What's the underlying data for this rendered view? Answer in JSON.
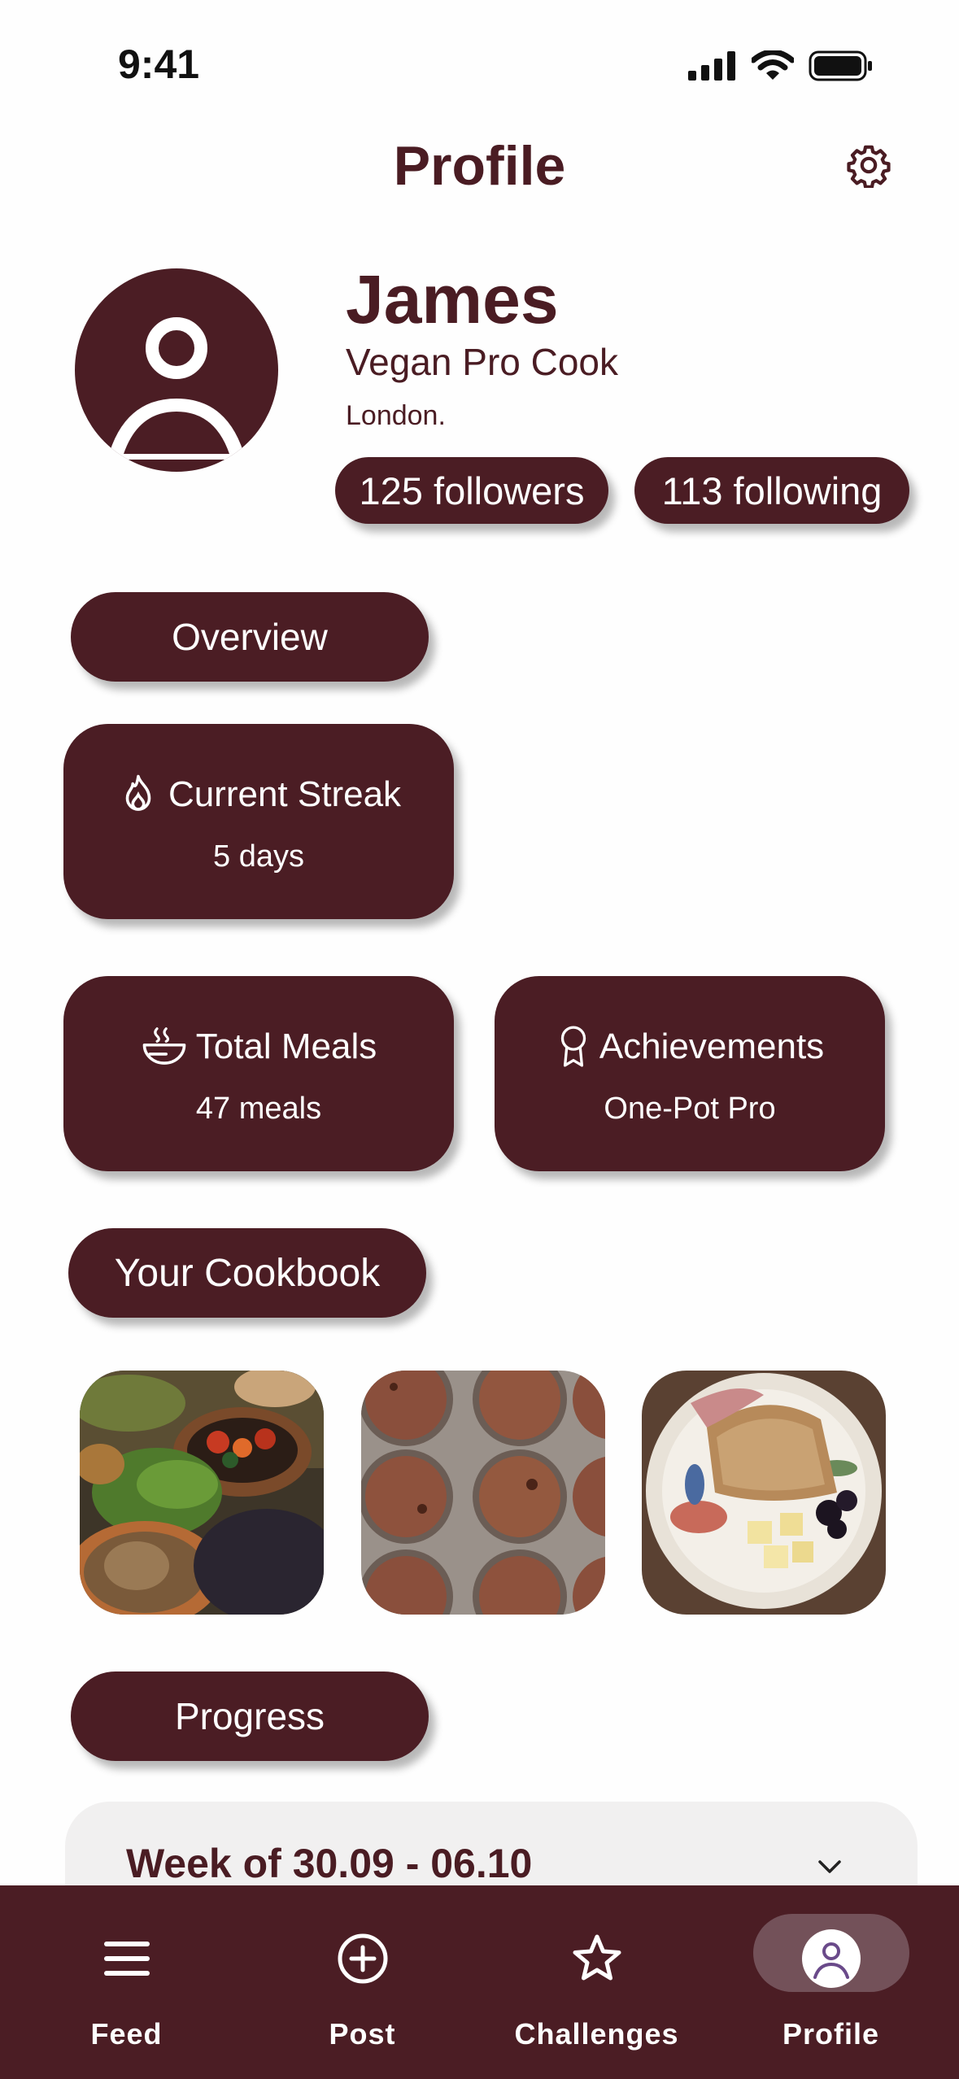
{
  "status": {
    "time": "9:41"
  },
  "header": {
    "title": "Profile"
  },
  "profile": {
    "name": "James",
    "role": "Vegan Pro Cook",
    "city": "London.",
    "followers": "125 followers",
    "following": "113 following"
  },
  "sections": {
    "overview": "Overview",
    "cookbook": "Your Cookbook",
    "progress": "Progress"
  },
  "stats": {
    "streak": {
      "title": "Current Streak",
      "value": "5 days",
      "icon": "flame-icon"
    },
    "meals": {
      "title": "Total Meals",
      "value": "47 meals",
      "icon": "bowl-icon"
    },
    "achievements": {
      "title": "Achievements",
      "value": "One-Pot Pro",
      "icon": "medal-icon"
    }
  },
  "cookbook": {
    "photos": [
      "vegetable-dishes-photo",
      "chocolate-muffins-photo",
      "sandwich-plate-photo"
    ]
  },
  "progress": {
    "week_label": "Week of 30.09 - 06.10"
  },
  "nav": {
    "items": [
      {
        "label": "Feed",
        "icon": "menu-icon"
      },
      {
        "label": "Post",
        "icon": "plus-circle-icon"
      },
      {
        "label": "Challenges",
        "icon": "star-icon"
      },
      {
        "label": "Profile",
        "icon": "user-icon",
        "active": true
      }
    ]
  },
  "colors": {
    "brand": "#4b1d24",
    "active_nav": "#735159",
    "card_bg": "#f1f0f0"
  }
}
